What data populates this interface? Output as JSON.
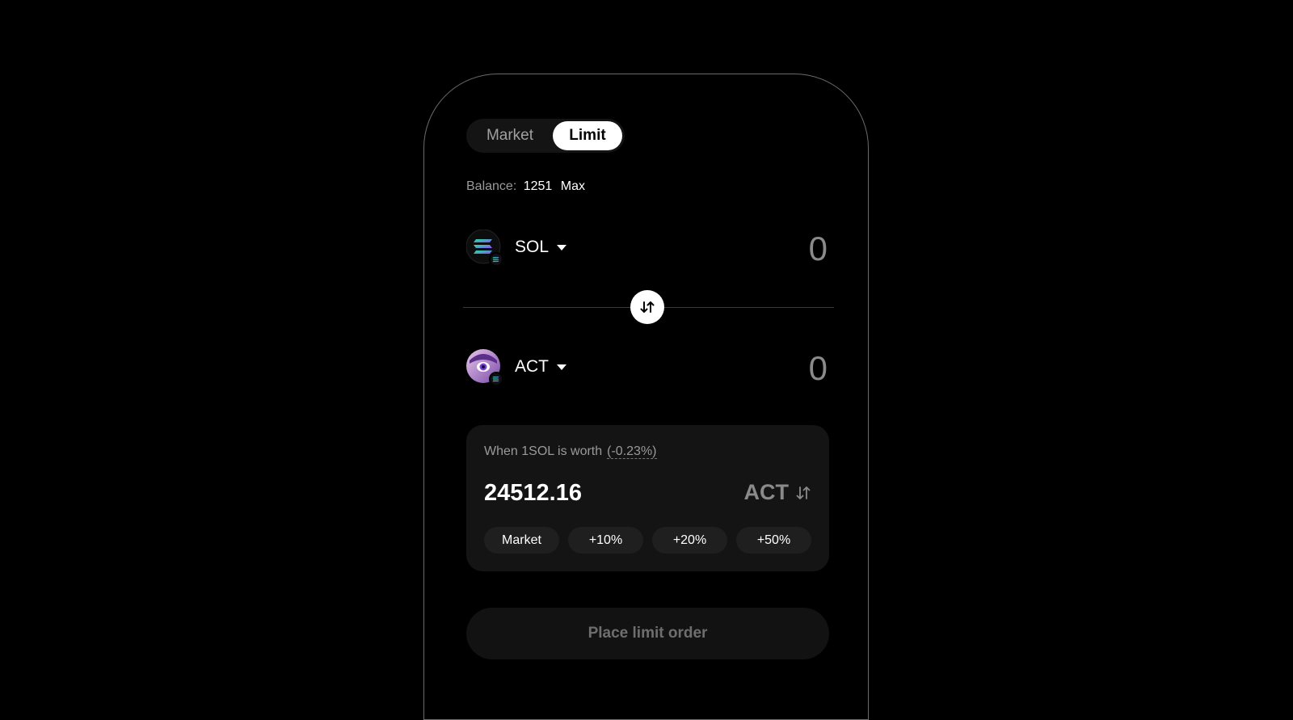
{
  "tabs": [
    {
      "label": "Market",
      "active": false
    },
    {
      "label": "Limit",
      "active": true
    }
  ],
  "balance": {
    "label": "Balance:",
    "value": "1251",
    "max_label": "Max"
  },
  "from_token": {
    "symbol": "SOL",
    "amount": "0",
    "icon": "solana-logo-icon"
  },
  "to_token": {
    "symbol": "ACT",
    "amount": "0",
    "icon": "act-avatar-icon"
  },
  "swap_icon": "swap-arrows-icon",
  "limit": {
    "when_label": "When 1SOL is worth",
    "change_pct": "(-0.23%)",
    "price": "24512.16",
    "price_token": "ACT",
    "chips": [
      "Market",
      "+10%",
      "+20%",
      "+50%"
    ]
  },
  "place_button_label": "Place limit order",
  "colors": {
    "background": "#000000",
    "card": "#141414",
    "muted_text": "#9a9a9a",
    "sol_gradient_start": "#9945FF",
    "sol_gradient_end": "#14F195"
  }
}
